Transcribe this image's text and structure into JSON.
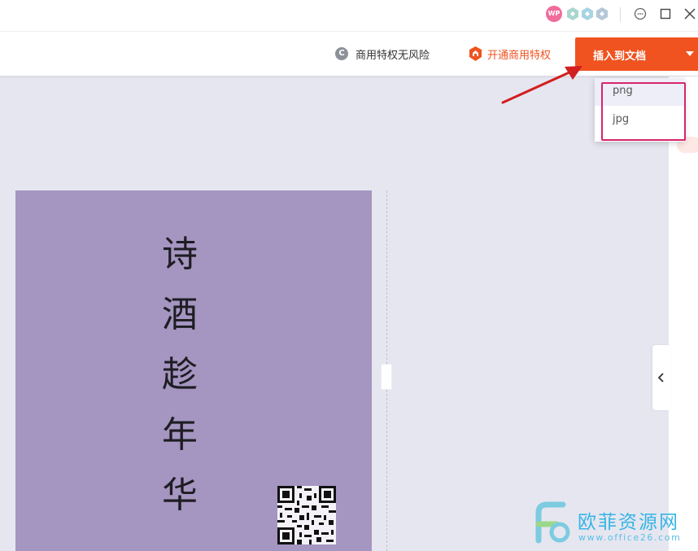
{
  "titlebar": {
    "avatar_text": "WP",
    "badge_colors": [
      "#a9d6ce",
      "#a8d3e4",
      "#b5c7d8"
    ]
  },
  "toolbar": {
    "risk_icon_letter": "C",
    "risk_label": "商用特权无风险",
    "open_label": "开通商用特权",
    "insert_label": "插入到文档",
    "accent_color": "#f0531f"
  },
  "dropdown": {
    "options": [
      "png",
      "jpg"
    ]
  },
  "poster": {
    "background_color": "#a595c1",
    "poem_chars": [
      "诗",
      "酒",
      "趁",
      "年",
      "华"
    ]
  },
  "watermark": {
    "title": "欧菲资源网",
    "url": "www.office26.com"
  }
}
